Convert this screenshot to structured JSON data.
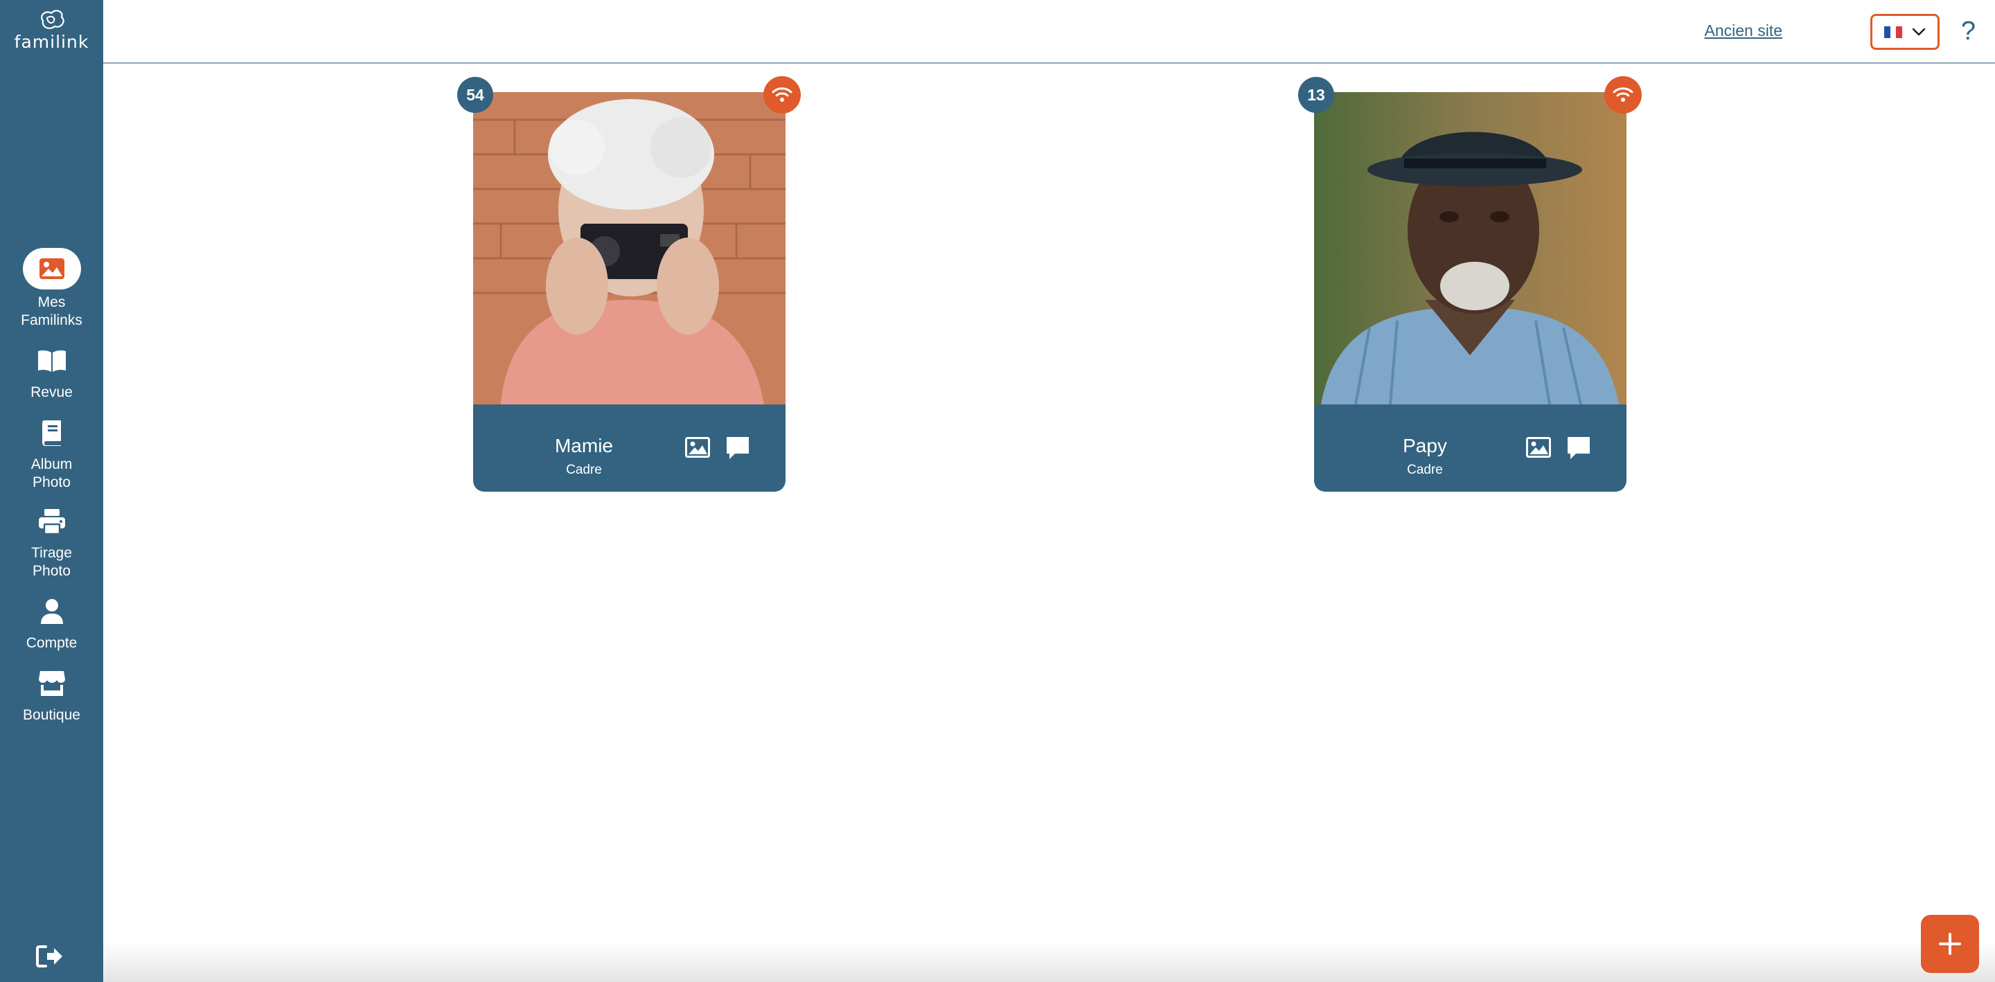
{
  "app": {
    "logo_text": "familink"
  },
  "sidebar": {
    "items": [
      {
        "label_line1": "Mes",
        "label_line2": "Familinks",
        "icon": "image-icon",
        "active": true
      },
      {
        "label_line1": "Revue",
        "label_line2": "",
        "icon": "book-icon",
        "active": false
      },
      {
        "label_line1": "Album",
        "label_line2": "Photo",
        "icon": "album-icon",
        "active": false
      },
      {
        "label_line1": "Tirage",
        "label_line2": "Photo",
        "icon": "printer-icon",
        "active": false
      },
      {
        "label_line1": "Compte",
        "label_line2": "",
        "icon": "user-icon",
        "active": false
      },
      {
        "label_line1": "Boutique",
        "label_line2": "",
        "icon": "store-icon",
        "active": false
      }
    ],
    "logout_icon": "logout-icon"
  },
  "header": {
    "old_site_label": "Ancien site",
    "language_icon": "france-flag-icon",
    "help_label": "?"
  },
  "frames": [
    {
      "count": "54",
      "name": "Mamie",
      "type": "Cadre",
      "status_icon": "wifi-icon"
    },
    {
      "count": "13",
      "name": "Papy",
      "type": "Cadre",
      "status_icon": "wifi-icon"
    }
  ],
  "fab": {
    "label": "+"
  },
  "colors": {
    "primary": "#336380",
    "accent": "#e05a2b",
    "background": "#ffffff"
  }
}
